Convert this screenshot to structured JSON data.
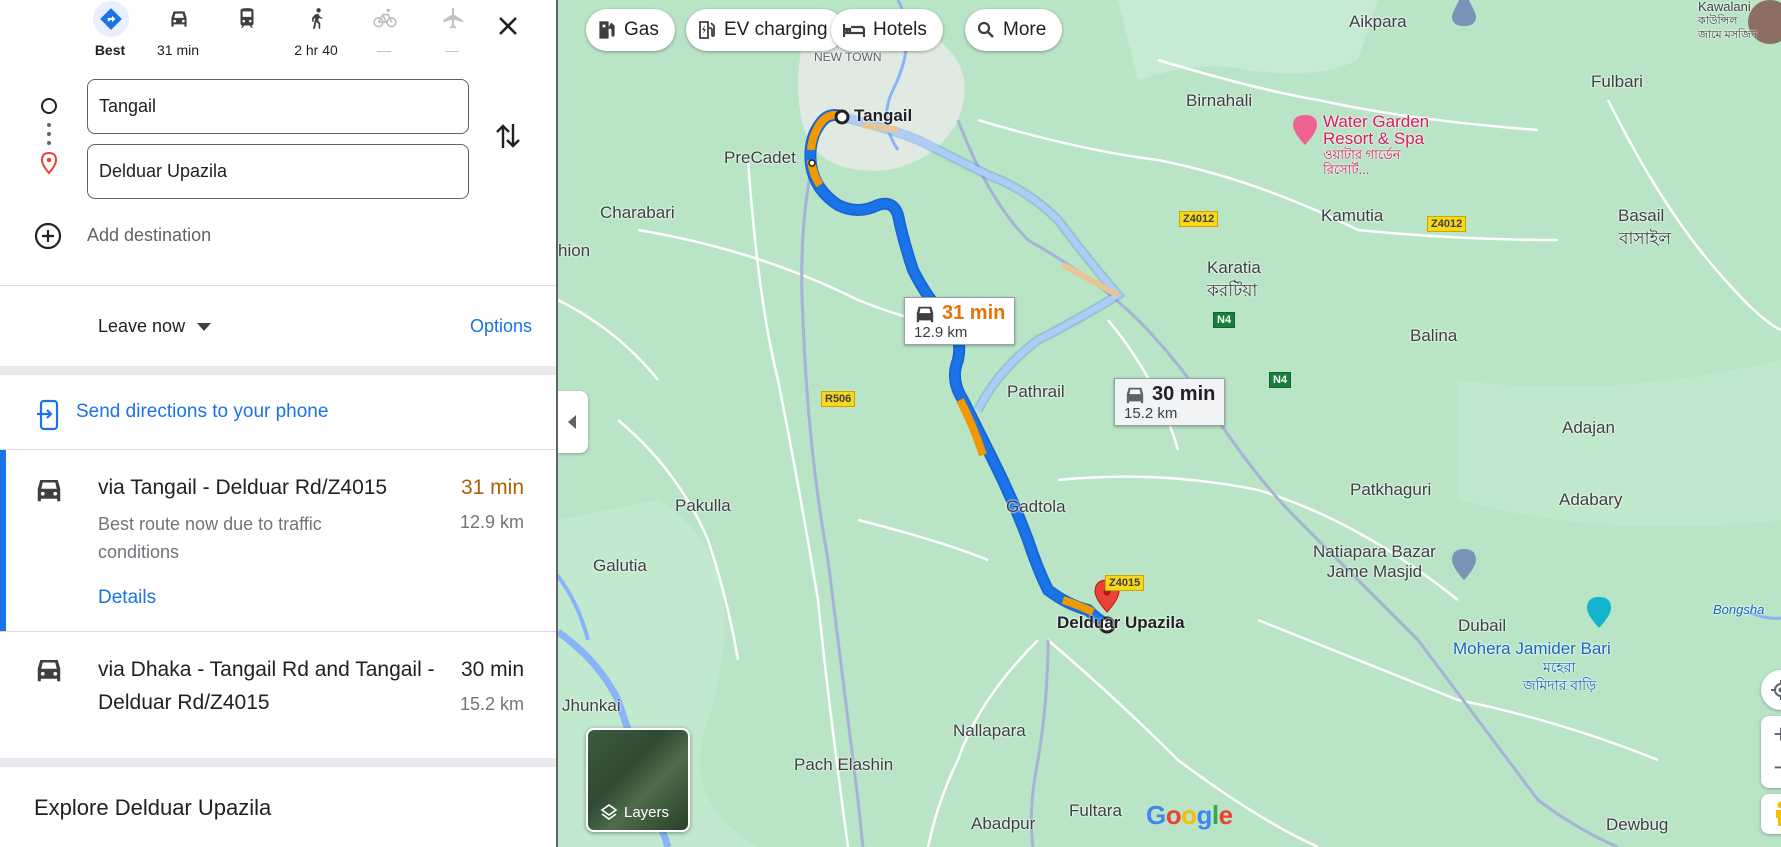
{
  "travel_modes": [
    {
      "id": "best",
      "label": "Best",
      "icon": "directions-icon",
      "active": true
    },
    {
      "id": "driving",
      "label": "31 min",
      "icon": "car-icon"
    },
    {
      "id": "transit",
      "label": "",
      "icon": "train-icon"
    },
    {
      "id": "walking",
      "label": "2 hr 40",
      "icon": "walk-icon"
    },
    {
      "id": "cycling",
      "label": "—",
      "icon": "bike-icon",
      "disabled": true
    },
    {
      "id": "flight",
      "label": "—",
      "icon": "plane-icon",
      "disabled": true
    }
  ],
  "waypoints": {
    "origin": "Tangail",
    "destination": "Delduar Upazila",
    "add_destination": "Add destination"
  },
  "depart": {
    "leave_now": "Leave now",
    "options": "Options"
  },
  "send_directions": "Send directions to your phone",
  "routes": [
    {
      "title": "via Tangail - Delduar Rd/Z4015",
      "time": "31 min",
      "distance": "12.9 km",
      "description": "Best route now due to traffic conditions",
      "details": "Details",
      "time_color": "#b06000"
    },
    {
      "title": "via Dhaka - Tangail Rd and Tangail - Delduar Rd/Z4015",
      "time": "30 min",
      "distance": "15.2 km",
      "time_color": "#202124"
    }
  ],
  "explore": "Explore Delduar Upazila",
  "map": {
    "chips": [
      "Gas",
      "EV charging",
      "Hotels",
      "More"
    ],
    "callouts": {
      "primary": {
        "time": "31 min",
        "distance": "12.9 km",
        "color": "#e8710a"
      },
      "alternate": {
        "time": "30 min",
        "distance": "15.2 km",
        "color": "#202124"
      }
    },
    "places": {
      "aikpara": "Aikpara",
      "fulbari": "Fulbari",
      "new_town": "NEW TOWN",
      "tangail": "Tangail",
      "birnahali": "Birnahali",
      "water_garden_1": "Water Garden",
      "water_garden_2": "Resort & Spa",
      "water_garden_bn_1": "ওয়াটার গার্ডেন",
      "water_garden_bn_2": "রিসোর্ট...",
      "precadet": "PreCadet",
      "charabari": "Charabari",
      "kamutia": "Kamutia",
      "basail": "Basail",
      "basail_bn": "বাসাইল",
      "karatia": "Karatia",
      "karatia_bn": "করটিয়া",
      "hion": "hion",
      "balina": "Balina",
      "pathrail": "Pathrail",
      "adajan": "Adajan",
      "pakulla": "Pakulla",
      "gadtola": "Gadtola",
      "patkhaguri": "Patkhaguri",
      "adabary": "Adabary",
      "galutia": "Galutia",
      "natiapara_1": "Natiapara Bazar",
      "natiapara_2": "Jame Masjid",
      "delduar": "Delduar Upazila",
      "dubail": "Dubail",
      "mohera": "Mohera Jamider Bari",
      "mohera_bn_1": "মহেরা",
      "mohera_bn_2": "জমিদার বাড়ি",
      "bongsha": "Bongsha",
      "jhunkai": "Jhunkai",
      "nallapara": "Nallapara",
      "pach_elashin": "Pach Elashin",
      "abadpur": "Abadpur",
      "fultara": "Fultara",
      "dewbug": "Dewbug",
      "kawalani": "Kawalani",
      "kawalani_bn": "কাউন্সিল জামে মসজিদ"
    },
    "road_labels": [
      "Z4012",
      "Z4012",
      "N4",
      "N4",
      "R506",
      "Z4015"
    ],
    "layers": "Layers",
    "logo": "Google"
  }
}
